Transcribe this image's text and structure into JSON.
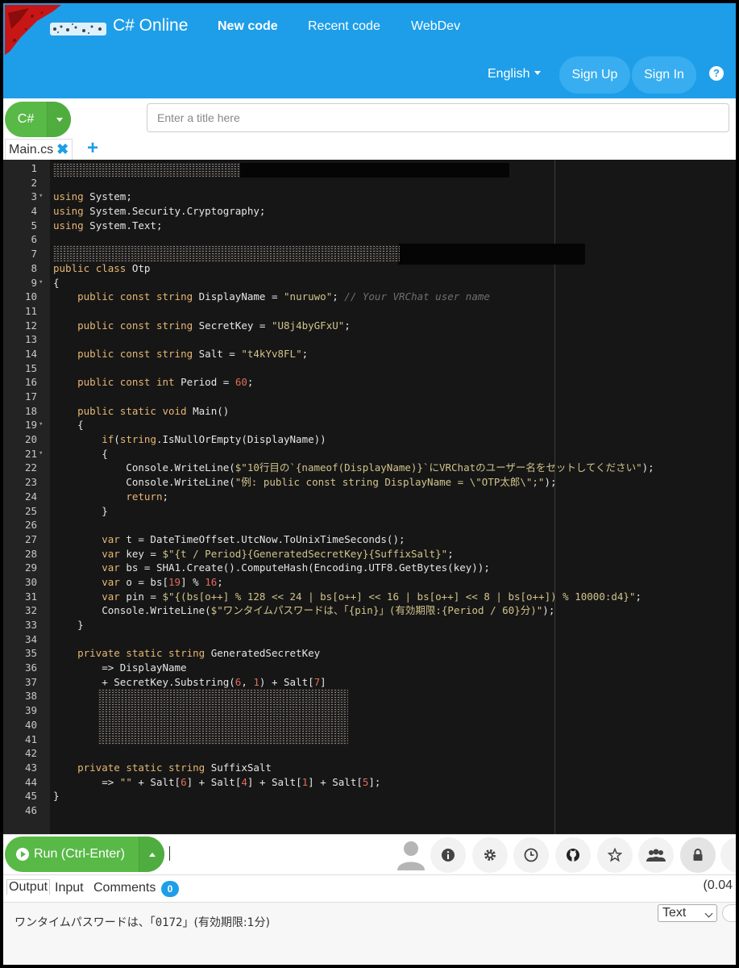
{
  "header": {
    "brand": "C# Online",
    "nav": {
      "new_code": "New code",
      "recent_code": "Recent code",
      "webdev": "WebDev"
    },
    "language": "English",
    "sign_up": "Sign Up",
    "sign_in": "Sign In",
    "help": "?"
  },
  "toolbar": {
    "language_button": "C#",
    "title_placeholder": "Enter a title here",
    "tabs": [
      {
        "label": "Main.cs"
      }
    ],
    "add_tab": "+"
  },
  "editor": {
    "lines": [
      "",
      "",
      "using System;",
      "using System.Security.Cryptography;",
      "using System.Text;",
      "",
      "",
      "public class Otp",
      "{",
      "    public const string DisplayName = \"nuruwo\"; // Your VRChat user name",
      "",
      "    public const string SecretKey = \"U8j4byGFxU\";",
      "",
      "    public const string Salt = \"t4kYv8FL\";",
      "",
      "    public const int Period = 60;",
      "",
      "    public static void Main()",
      "    {",
      "        if(string.IsNullOrEmpty(DisplayName))",
      "        {",
      "            Console.WriteLine($\"10行目の`{nameof(DisplayName)}`にVRChatのユーザー名をセットしてください\");",
      "            Console.WriteLine(\"例: public const string DisplayName = \\\"OTP太郎\\\";\");",
      "            return;",
      "        }",
      "",
      "        var t = DateTimeOffset.UtcNow.ToUnixTimeSeconds();",
      "        var key = $\"{t / Period}{GeneratedSecretKey}{SuffixSalt}\";",
      "        var bs = SHA1.Create().ComputeHash(Encoding.UTF8.GetBytes(key));",
      "        var o = bs[19] % 16;",
      "        var pin = $\"{(bs[o++] % 128 << 24 | bs[o++] << 16 | bs[o++] << 8 | bs[o++]) % 10000:d4}\";",
      "        Console.WriteLine($\"ワンタイムパスワードは、「{pin}」(有効期限:{Period / 60}分)\");",
      "    }",
      "",
      "    private static string GeneratedSecretKey",
      "        => DisplayName",
      "        + SecretKey.Substring(6, 1) + Salt[7]",
      "",
      "",
      "",
      "",
      "",
      "    private static string SuffixSalt",
      "        => \"\" + Salt[6] + Salt[4] + Salt[1] + Salt[5];",
      "}",
      ""
    ]
  },
  "runbar": {
    "run_label": "Run (Ctrl-Enter)",
    "tools": [
      "info-icon",
      "gear-icon",
      "clock-icon",
      "github-icon",
      "star-icon",
      "users-icon",
      "lock-icon"
    ]
  },
  "output": {
    "tabs": {
      "output": "Output",
      "input": "Input",
      "comments": "Comments"
    },
    "comments_count": "0",
    "elapsed": "(0.04",
    "text_prefix": "ワンタイムパスワードは、「",
    "text_pin": "0172",
    "text_suffix": "」(有効期限:1分)",
    "format": "Text"
  },
  "colors": {
    "header_blue": "#1e9ee8",
    "run_green": "#58b947",
    "editor_bg": "#161616",
    "keyword": "#e6b673",
    "string": "#d1c38a",
    "number": "#e06c5a"
  }
}
